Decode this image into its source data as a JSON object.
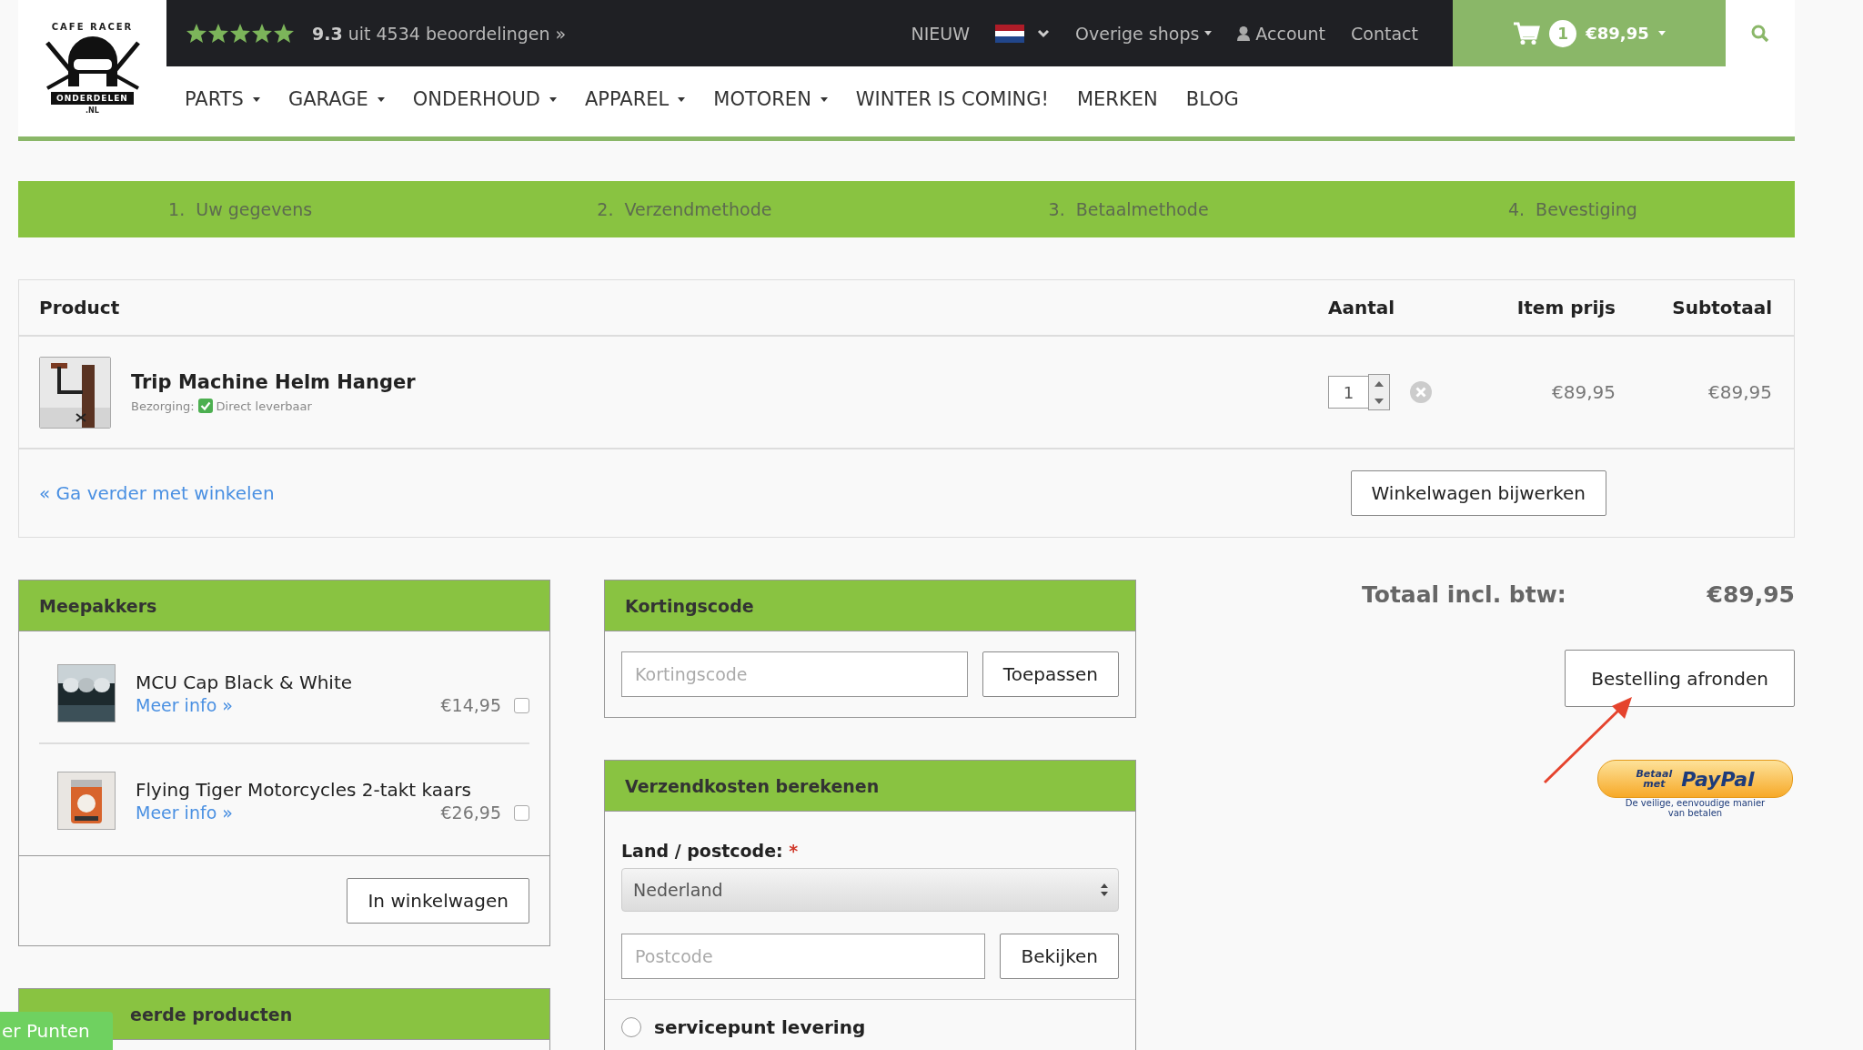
{
  "logo": {
    "top_text": "CAFE RACER",
    "banner": "ONDERDELEN",
    "domain": ".NL"
  },
  "topbar": {
    "rating": {
      "stars": 5,
      "score": "9.3",
      "text": "uit 4534 beoordelingen »"
    },
    "new_link": "NIEUW",
    "shops_menu": "Overige shops",
    "account_link": "Account",
    "contact_link": "Contact"
  },
  "cart": {
    "count": "1",
    "total": "€89,95"
  },
  "nav": [
    {
      "label": "PARTS",
      "dropdown": true
    },
    {
      "label": "GARAGE",
      "dropdown": true
    },
    {
      "label": "ONDERHOUD",
      "dropdown": true
    },
    {
      "label": "APPAREL",
      "dropdown": true
    },
    {
      "label": "MOTOREN",
      "dropdown": true
    },
    {
      "label": "WINTER IS COMING!",
      "dropdown": false
    },
    {
      "label": "MERKEN",
      "dropdown": false
    },
    {
      "label": "BLOG",
      "dropdown": false
    }
  ],
  "steps": [
    {
      "number": "1.",
      "label": "Uw gegevens"
    },
    {
      "number": "2.",
      "label": "Verzendmethode"
    },
    {
      "number": "3.",
      "label": "Betaalmethode"
    },
    {
      "number": "4.",
      "label": "Bevestiging"
    }
  ],
  "cart_table": {
    "columns": [
      "Product",
      "Aantal",
      "Item prijs",
      "Subtotaal"
    ],
    "rows": [
      {
        "kind": "picture",
        "name": "Trip Machine Helm Hanger",
        "delivery_label": "Bezorging:",
        "delivery_status": "Direct leverbaar",
        "in_stock": true,
        "quantity": "1",
        "item_price": "€89,95",
        "subtotal": "€89,95"
      }
    ],
    "continue_link": "« Ga verder met winkelen",
    "update_button": "Winkelwagen bijwerken"
  },
  "extras": {
    "title": "Meepakkers",
    "items": [
      {
        "name": "MCU Cap Black & White",
        "link": "Meer info »",
        "price": "€14,95",
        "checked": false
      },
      {
        "name": "Flying Tiger Motorcycles 2-takt kaars",
        "link": "Meer info »",
        "price": "€26,95",
        "checked": false
      }
    ],
    "button": "In winkelwagen"
  },
  "related": {
    "title": "eerde producten"
  },
  "discount": {
    "title": "Kortingscode",
    "placeholder": "Kortingscode",
    "button": "Toepassen"
  },
  "shipping": {
    "title": "Verzendkosten berekenen",
    "field_label": "Land / postcode:",
    "required_mark": "*",
    "country": "Nederland",
    "postcode_placeholder": "Postcode",
    "button": "Bekijken",
    "options": [
      {
        "label": "servicepunt levering",
        "selected": false
      }
    ]
  },
  "total": {
    "label": "Totaal incl. btw:",
    "value": "€89,95"
  },
  "checkout_button": "Bestelling afronden",
  "paypal": {
    "prefix_top": "Betaal",
    "prefix_bottom": "met",
    "brand": "PayPal",
    "tagline": "De veilige, eenvoudige manier van betalen"
  },
  "points_badge": "er Punten"
}
